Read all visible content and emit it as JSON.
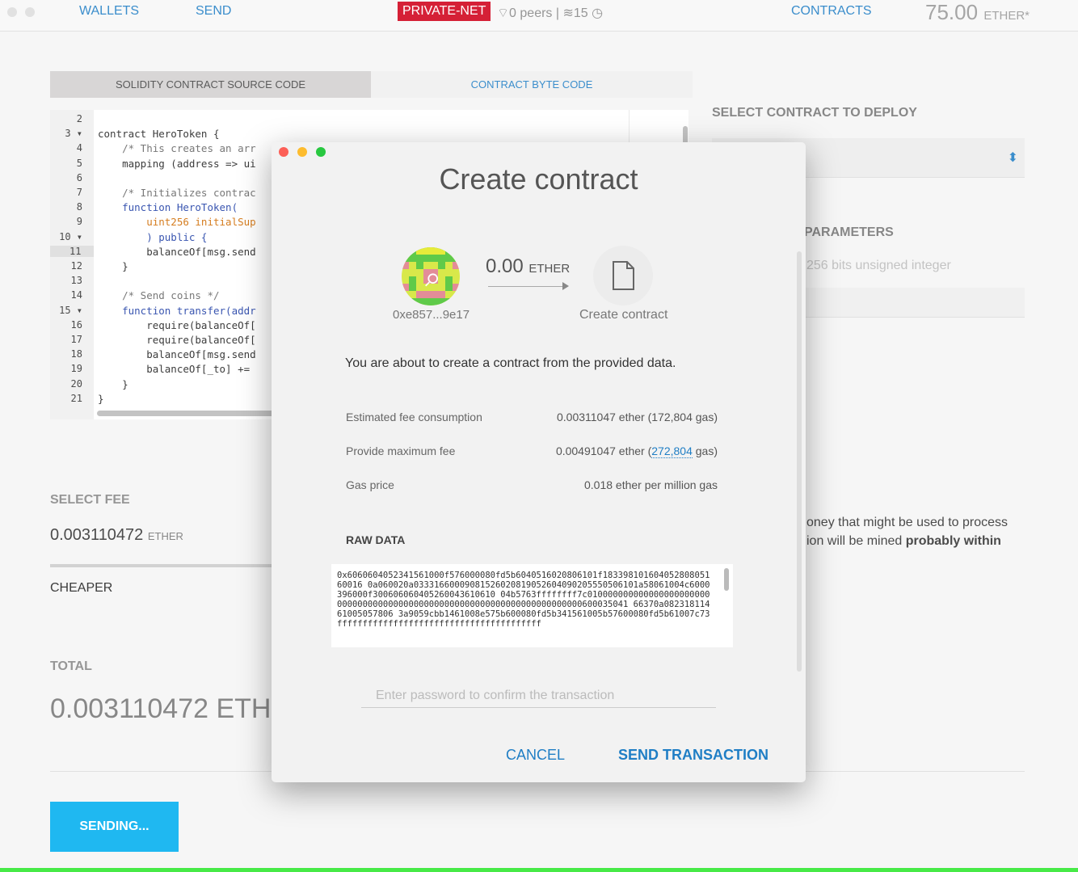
{
  "topbar": {
    "nav_wallets": "WALLETS",
    "nav_send": "SEND",
    "network_badge": "PRIVATE-NET",
    "peers": "0 peers",
    "separator": "|",
    "block_number": "15",
    "nav_contracts": "CONTRACTS",
    "balance_value": "75.00",
    "balance_unit": "ETHER*"
  },
  "editor_tabs": {
    "source": "SOLIDITY CONTRACT SOURCE CODE",
    "bytecode": "CONTRACT BYTE CODE"
  },
  "editor": {
    "line_numbers": [
      "2",
      "3 ▾",
      "4",
      "5",
      "6",
      "7",
      "8",
      "9",
      "10 ▾",
      "11",
      "12",
      "13",
      "14",
      "15 ▾",
      "16",
      "17",
      "18",
      "19",
      "20",
      "21"
    ],
    "lines": [
      "",
      "contract HeroToken {",
      "    /* This creates an arr",
      "    mapping (address => ui",
      "",
      "    /* Initializes contrac",
      "    function HeroToken(",
      "        uint256 initialSup",
      "        ) public {",
      "        balanceOf[msg.send",
      "    }",
      "",
      "    /* Send coins */",
      "    function transfer(addr",
      "        require(balanceOf[",
      "        require(balanceOf[",
      "        balanceOf[msg.send",
      "        balanceOf[_to] +=",
      "    }",
      "}"
    ]
  },
  "right_panel": {
    "select_contract_title": "SELECT CONTRACT TO DEPLOY",
    "params_title": "PARAMETERS",
    "param_hint": "256 bits unsigned integer",
    "fee_note_line1": "oney that might be used to process",
    "fee_note_line2_prefix": "ion will be mined ",
    "fee_note_line2_bold": "probably within"
  },
  "fee_section": {
    "title": "SELECT FEE",
    "value": "0.003110472",
    "unit": "ETHER",
    "cheaper": "CHEAPER",
    "total_title": "TOTAL",
    "total_value": "0.003110472 ETHE"
  },
  "send_button": "SENDING...",
  "modal": {
    "title": "Create contract",
    "from_address": "0xe857...9e17",
    "amount": "0.00",
    "amount_unit": "ETHER",
    "to_label": "Create contract",
    "about_text": "You are about to create a contract from the provided data.",
    "rows": [
      {
        "label": "Estimated fee consumption",
        "value": "0.00311047 ether (172,804 gas)"
      },
      {
        "label": "Provide maximum fee",
        "value_prefix": "0.00491047 ether (",
        "value_link": "272,804",
        "value_suffix": " gas)"
      },
      {
        "label": "Gas price",
        "value": "0.018 ether per million gas"
      }
    ],
    "raw_title": "RAW DATA",
    "raw_data": "0x6060604052341561000f576000080fd5b6040516020806101f18339810160405280805160016 0a060020a03331660009081526020819052604090205550506101a58061004c6000396000f300606060405260043610610 04b5763ffffffff7c010000000000000000000000000000000000000000000000000000000000000000000000600035041 66370a08231811461005057806 3a9059cbb1461008e575b600080fd5b341561005b57600080fd5b61007c73ffffffffffffffffffffffffffffffffffffffff",
    "password_placeholder": "Enter password to confirm the transaction",
    "cancel": "CANCEL",
    "send_transaction": "SEND TRANSACTION"
  },
  "colors": {
    "accent": "#1f7ec5",
    "network_red": "#d0021b",
    "send_button": "#00aff0",
    "progress_green": "#2ee82e"
  }
}
